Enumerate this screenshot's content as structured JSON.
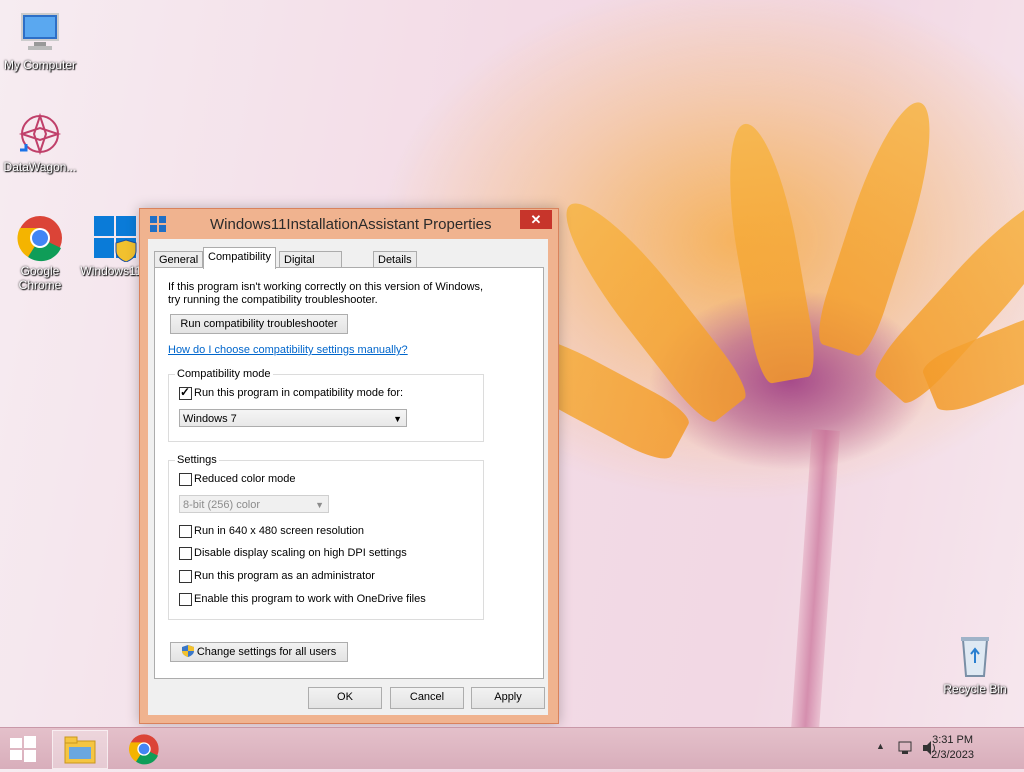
{
  "desktop": {
    "icons": [
      {
        "label": "My Computer",
        "icon": "computer-icon"
      },
      {
        "label": "DataWagon...",
        "icon": "datawagon-icon"
      },
      {
        "label": "Google Chrome",
        "icon": "chrome-icon"
      },
      {
        "label": "Windows11...",
        "icon": "windows-installer-icon"
      },
      {
        "label": "Recycle Bin",
        "icon": "recycle-bin-icon"
      }
    ]
  },
  "dialog": {
    "title": "Windows11InstallationAssistant Properties",
    "close_glyph": "✕",
    "tabs": [
      {
        "label": "General"
      },
      {
        "label": "Compatibility"
      },
      {
        "label": "Digital Signatures"
      },
      {
        "label": "Details"
      }
    ],
    "active_tab": "Compatibility",
    "intro_line1": "If this program isn't working correctly on this version of Windows,",
    "intro_line2": "try running the compatibility troubleshooter.",
    "troubleshooter_button": "Run compatibility troubleshooter",
    "manual_link": "How do I choose compatibility settings manually?",
    "compat_mode": {
      "group_label": "Compatibility mode",
      "checkbox_label": "Run this program in compatibility mode for:",
      "checked": true,
      "selected_os": "Windows 7"
    },
    "settings": {
      "group_label": "Settings",
      "reduced_color": {
        "label": "Reduced color mode",
        "checked": false
      },
      "color_select": "8-bit (256) color",
      "options": [
        {
          "label": "Run in 640 x 480 screen resolution",
          "checked": false
        },
        {
          "label": "Disable display scaling on high DPI settings",
          "checked": false
        },
        {
          "label": "Run this program as an administrator",
          "checked": false
        },
        {
          "label": "Enable this program to work with OneDrive files",
          "checked": false
        }
      ]
    },
    "change_all_users_button": "Change settings for all users",
    "ok": "OK",
    "cancel": "Cancel",
    "apply": "Apply"
  },
  "taskbar": {
    "time": "3:31 PM",
    "date": "2/3/2023",
    "tray_chevron": "▲"
  }
}
